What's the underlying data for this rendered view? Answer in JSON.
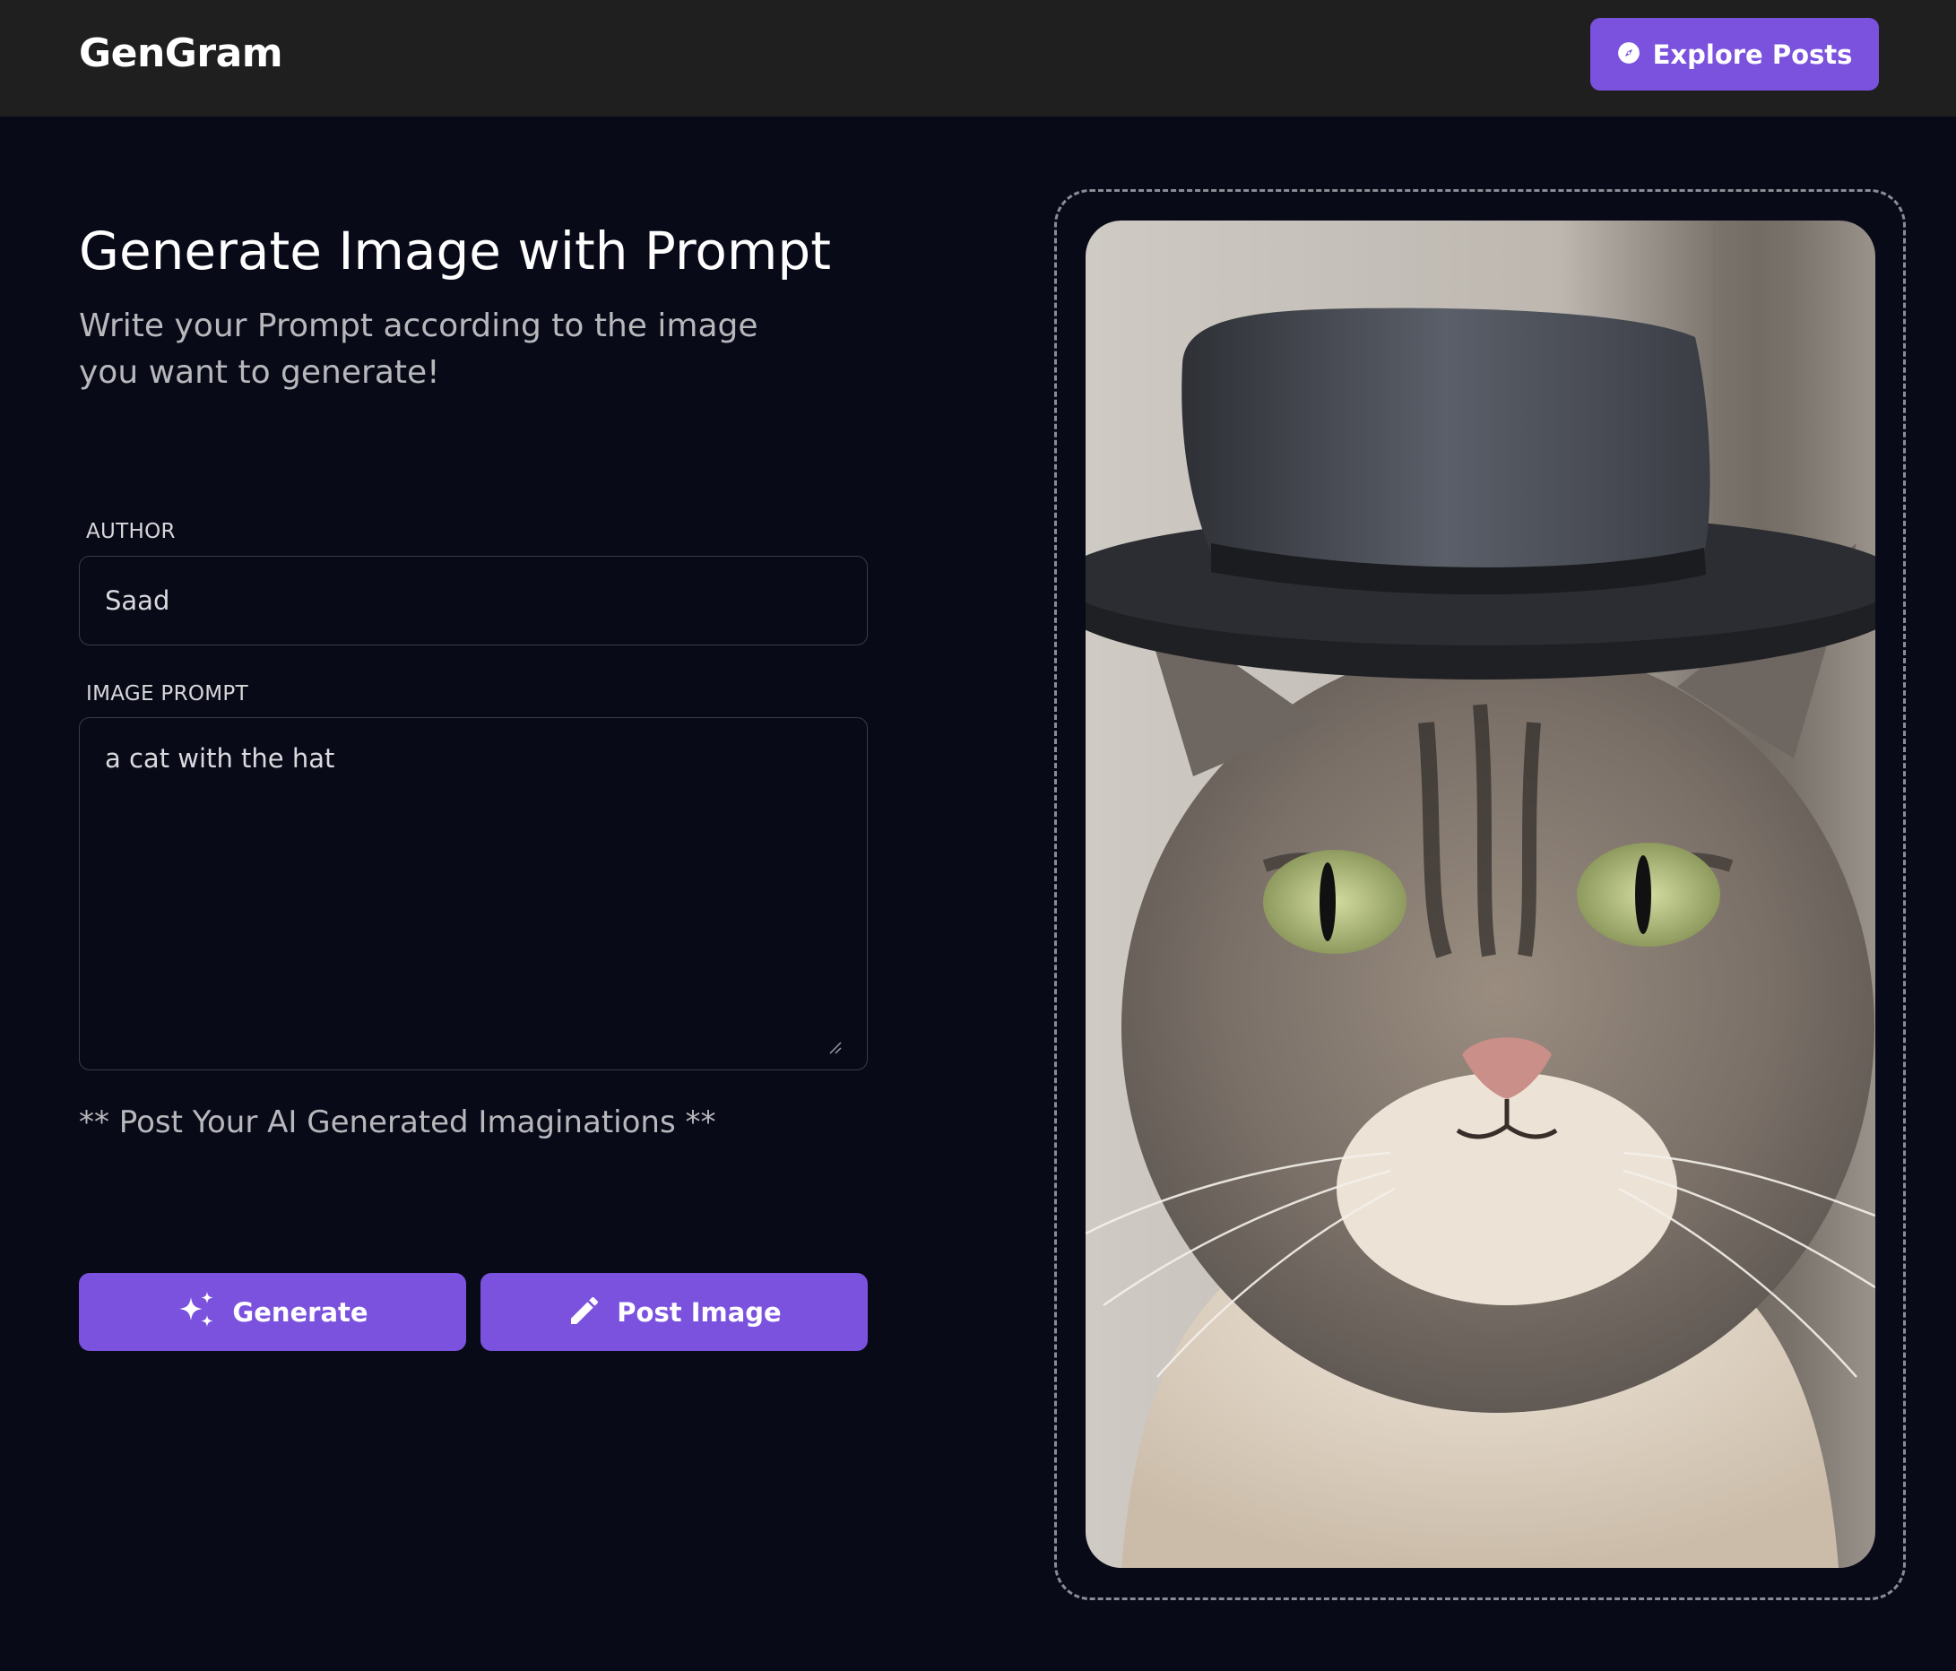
{
  "header": {
    "brand": "GenGram",
    "explore_label": "Explore Posts"
  },
  "main": {
    "title": "Generate Image with Prompt",
    "subtitle": "Write your Prompt according to the image you want to generate!",
    "author": {
      "label": "AUTHOR",
      "value": "Saad"
    },
    "prompt": {
      "label": "IMAGE PROMPT",
      "value": "a cat with the hat"
    },
    "tagline": "** Post Your AI Generated Imaginations **",
    "generate_label": "Generate",
    "post_label": "Post Image"
  },
  "preview": {
    "subject": "cat-with-hat-image"
  },
  "colors": {
    "accent": "#7b52dd",
    "background": "#090a18",
    "topbar": "#1f1f1f"
  }
}
